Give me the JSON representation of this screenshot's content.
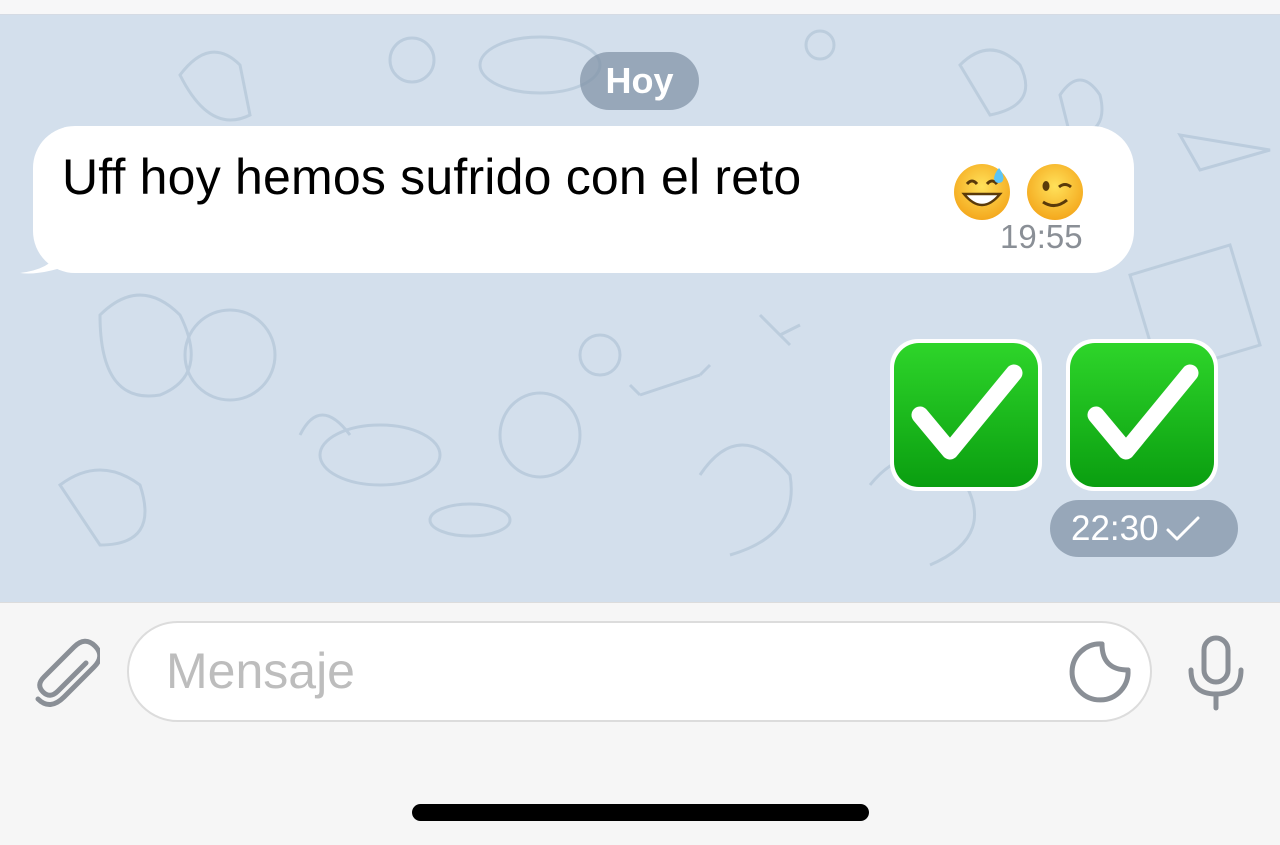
{
  "chat": {
    "date_label": "Hoy",
    "incoming": {
      "text": "Uff hoy hemos sufrido con el reto",
      "emojis": [
        "grinning-face-with-sweat",
        "winking-face"
      ],
      "time": "19:55"
    },
    "outgoing": {
      "emojis": [
        "check-mark-button",
        "check-mark-button"
      ],
      "time": "22:30",
      "status": "sent-single-check"
    }
  },
  "composer": {
    "placeholder": "Mensaje",
    "attach_icon": "paperclip-icon",
    "sticker_icon": "sticker-icon",
    "mic_icon": "microphone-icon"
  },
  "colors": {
    "chat_background": "#d3dfec",
    "pill": "#8091a5",
    "check_green": "#1fbd1a"
  }
}
